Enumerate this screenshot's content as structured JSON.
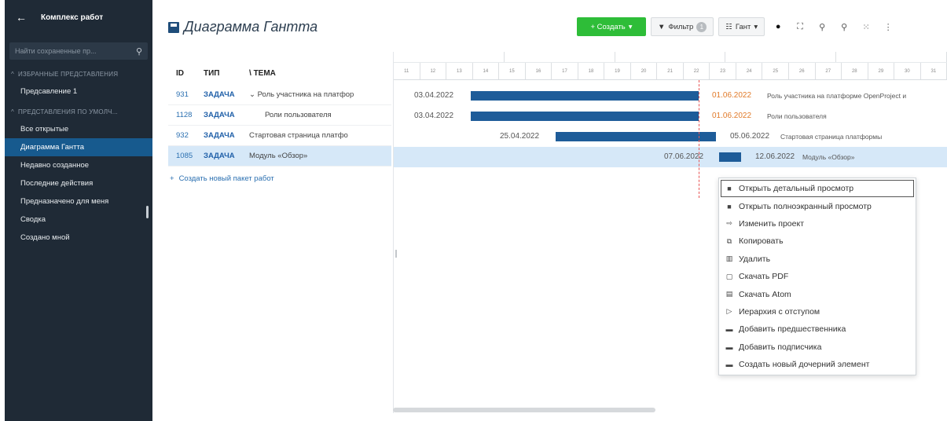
{
  "sidebar": {
    "back_icon": "arrow-left-icon",
    "title": "Комплекс работ",
    "search_placeholder": "Найти сохраненные пр...",
    "sections": [
      {
        "label": "ИЗБРАННЫЕ ПРЕДСТАВЛЕНИЯ",
        "items": [
          "Предсавление 1"
        ]
      },
      {
        "label": "ПРЕДСТАВЛЕНИЯ ПО УМОЛЧ...",
        "items": [
          "Все открытые",
          "Диаграмма Гантта",
          "Недавно созданное",
          "Последние действия",
          "Предназначено для меня",
          "Сводка",
          "Создано мной"
        ]
      }
    ],
    "active_item": "Диаграмма Гантта"
  },
  "header": {
    "title": "Диаграмма Гантта",
    "create_label": "+ Создать",
    "filter_label": "Фильтр",
    "filter_count": "1",
    "view_label": "Гант",
    "accent": "#2ebd38"
  },
  "table": {
    "columns": [
      "ID",
      "ТИП",
      "ТЕМА"
    ],
    "rows": [
      {
        "id": "931",
        "type": "ЗАДАЧА",
        "subject": "Роль участника на платфор",
        "expanded": true
      },
      {
        "id": "1128",
        "type": "ЗАДАЧА",
        "subject": "Роли пользователя"
      },
      {
        "id": "932",
        "type": "ЗАДАЧА",
        "subject": "Стартовая страница платфо"
      },
      {
        "id": "1085",
        "type": "ЗАДАЧА",
        "subject": "Модуль «Обзор»"
      }
    ],
    "create_link": "Создать новый пакет работ"
  },
  "gantt": {
    "header_days": [
      "11",
      "12",
      "13",
      "14",
      "15",
      "16",
      "17",
      "18",
      "19",
      "20",
      "21",
      "22",
      "23",
      "24",
      "25",
      "26",
      "27",
      "28",
      "29",
      "30",
      "31"
    ],
    "rows": [
      {
        "start": "03.04.2022",
        "end": "01.06.2022",
        "end_late": true,
        "label": "Роль участника на платформе OpenProject и"
      },
      {
        "start": "03.04.2022",
        "end": "01.06.2022",
        "end_late": true,
        "label": "Роли пользователя"
      },
      {
        "start": "25.04.2022",
        "end": "05.06.2022",
        "end_late": false,
        "label": "Стартовая страница платформы"
      },
      {
        "start": "07.06.2022",
        "end": "12.06.2022",
        "end_late": false,
        "label": "Модуль «Обзор»"
      }
    ]
  },
  "context_menu": {
    "items": [
      {
        "label": "Открыть детальный просмотр",
        "icon": "split-view-icon"
      },
      {
        "label": "Открыть полноэкранный просмотр",
        "icon": "fullscreen-view-icon"
      },
      {
        "label": "Изменить проект",
        "icon": "move-icon"
      },
      {
        "label": "Копировать",
        "icon": "copy-icon"
      },
      {
        "label": "Удалить",
        "icon": "delete-icon"
      },
      {
        "label": "Скачать PDF",
        "icon": "pdf-icon"
      },
      {
        "label": "Скачать Atom",
        "icon": "atom-icon"
      },
      {
        "label": "Иерархия с отступом",
        "icon": "indent-icon"
      },
      {
        "label": "Добавить предшественника",
        "icon": "predecessor-icon"
      },
      {
        "label": "Добавить подписчика",
        "icon": "follower-icon"
      },
      {
        "label": "Создать новый дочерний элемент",
        "icon": "child-icon"
      }
    ]
  }
}
